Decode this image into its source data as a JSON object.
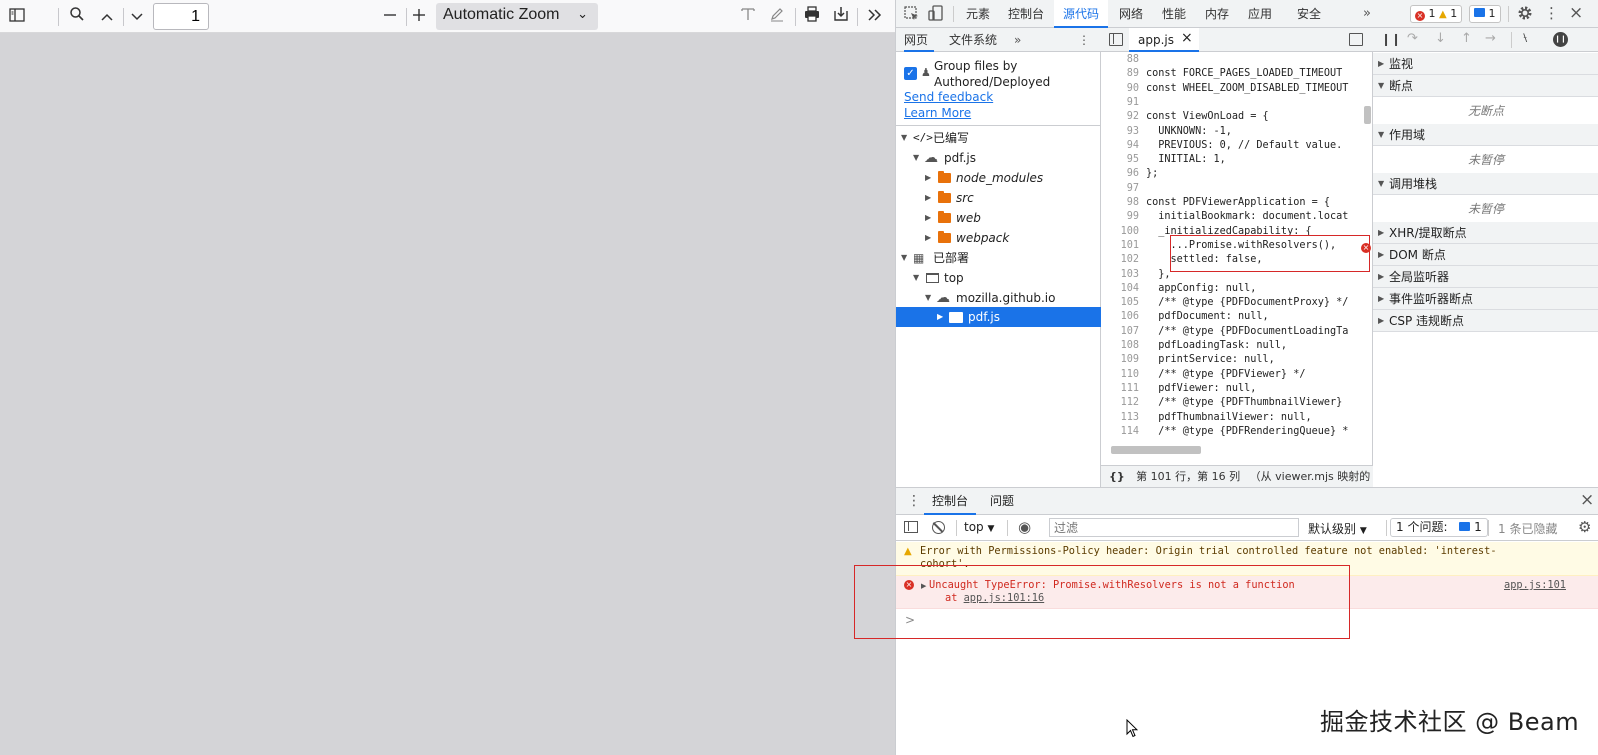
{
  "pdf_viewer": {
    "page_number": "1",
    "zoom": "Automatic Zoom",
    "icons": [
      "sidebar-toggle-icon",
      "search-icon",
      "chevron-up-icon",
      "chevron-down-icon",
      "zoom-out-icon",
      "zoom-in-icon",
      "text-tool-icon",
      "draw-tool-icon",
      "print-icon",
      "download-icon",
      "more-tools-icon"
    ]
  },
  "devtools": {
    "tabs": [
      "元素",
      "控制台",
      "源代码",
      "网络",
      "性能",
      "内存",
      "应用",
      "安全"
    ],
    "active_tab": "源代码",
    "badges": {
      "errors": "1",
      "warnings": "1",
      "messages": "1"
    },
    "navigator": {
      "tabs": [
        "网页",
        "文件系统"
      ],
      "group_files_label": "Group files by Authored/Deployed",
      "group_files_line1": "Group files by",
      "group_files_line2": "Authored/Deployed",
      "send_feedback": "Send feedback",
      "learn_more": "Learn More",
      "tree": {
        "authored": "已编写",
        "pdfjs_root": "pdf.js",
        "node_modules": "node_modules",
        "src": "src",
        "web": "web",
        "webpack": "webpack",
        "deployed": "已部署",
        "top": "top",
        "host": "mozilla.github.io",
        "pdfjs_selected": "pdf.js"
      }
    },
    "editor": {
      "file_tab": "app.js",
      "lines": [
        {
          "n": "88",
          "code": ""
        },
        {
          "n": "89",
          "code": "const FORCE_PAGES_LOADED_TIMEOUT"
        },
        {
          "n": "90",
          "code": "const WHEEL_ZOOM_DISABLED_TIMEOUT"
        },
        {
          "n": "91",
          "code": ""
        },
        {
          "n": "92",
          "code": "const ViewOnLoad = {"
        },
        {
          "n": "93",
          "code": "  UNKNOWN: -1,"
        },
        {
          "n": "94",
          "code": "  PREVIOUS: 0, // Default value."
        },
        {
          "n": "95",
          "code": "  INITIAL: 1,"
        },
        {
          "n": "96",
          "code": "};"
        },
        {
          "n": "97",
          "code": ""
        },
        {
          "n": "98",
          "code": "const PDFViewerApplication = {"
        },
        {
          "n": "99",
          "code": "  initialBookmark: document.locat"
        },
        {
          "n": "100",
          "code": "  _initializedCapability: {"
        },
        {
          "n": "101",
          "code": "    ...Promise.withResolvers(),"
        },
        {
          "n": "102",
          "code": "    settled: false,"
        },
        {
          "n": "103",
          "code": "  },"
        },
        {
          "n": "104",
          "code": "  appConfig: null,"
        },
        {
          "n": "105",
          "code": "  /** @type {PDFDocumentProxy} */"
        },
        {
          "n": "106",
          "code": "  pdfDocument: null,"
        },
        {
          "n": "107",
          "code": "  /** @type {PDFDocumentLoadingTa"
        },
        {
          "n": "108",
          "code": "  pdfLoadingTask: null,"
        },
        {
          "n": "109",
          "code": "  printService: null,"
        },
        {
          "n": "110",
          "code": "  /** @type {PDFViewer} */"
        },
        {
          "n": "111",
          "code": "  pdfViewer: null,"
        },
        {
          "n": "112",
          "code": "  /** @type {PDFThumbnailViewer}"
        },
        {
          "n": "113",
          "code": "  pdfThumbnailViewer: null,"
        },
        {
          "n": "114",
          "code": "  /** @type {PDFRenderingQueue} *"
        }
      ],
      "status": "第 101 行，第 16 列",
      "status_source": "（从 viewer.mjs 映射的"
    },
    "debugger": {
      "sections": [
        {
          "title": "监视",
          "expanded": false
        },
        {
          "title": "断点",
          "expanded": true,
          "body": "无断点"
        },
        {
          "title": "作用域",
          "expanded": true,
          "body": "未暂停"
        },
        {
          "title": "调用堆栈",
          "expanded": true,
          "body": "未暂停"
        },
        {
          "title": "XHR/提取断点",
          "expanded": false
        },
        {
          "title": "DOM 断点",
          "expanded": false
        },
        {
          "title": "全局监听器",
          "expanded": false
        },
        {
          "title": "事件监听器断点",
          "expanded": false
        },
        {
          "title": "CSP 违规断点",
          "expanded": false
        }
      ]
    },
    "console": {
      "drawer_tabs": [
        "控制台",
        "问题"
      ],
      "context": "top",
      "filter_placeholder": "过滤",
      "level": "默认级别",
      "issues_label": "1 个问题:",
      "issues_count": "1",
      "hidden": "1 条已隐藏",
      "warning_text": "Error with Permissions-Policy header: Origin trial controlled feature not enabled: 'interest-cohort'.",
      "warning_line1": "Error with Permissions-Policy header: Origin trial controlled feature not enabled: 'interest-",
      "warning_line2": "cohort'.",
      "error_text": "Uncaught TypeError: Promise.withResolvers is not a function",
      "error_at": "at",
      "error_location": "app.js:101:16",
      "error_source": "app.js:101",
      "prompt": ">"
    }
  },
  "watermark": "掘金技术社区 @ Beam"
}
